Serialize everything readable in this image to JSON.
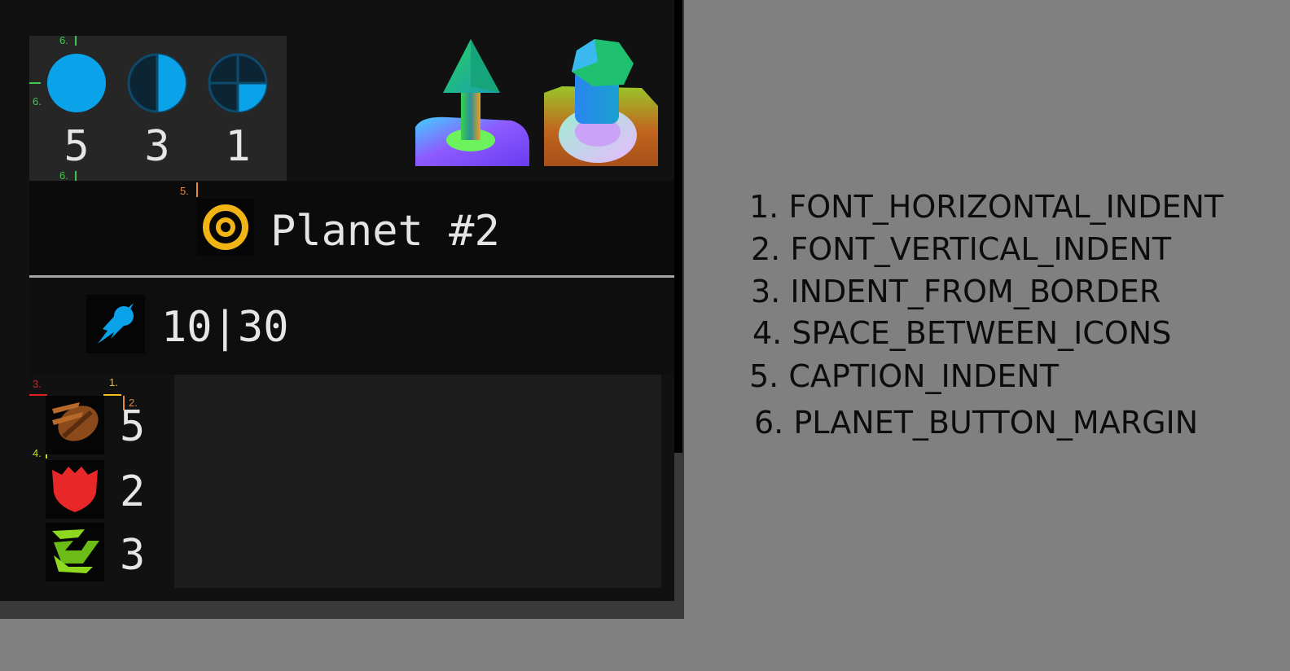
{
  "orbs": {
    "counts": [
      "5",
      "3",
      "1"
    ],
    "icons": [
      "orb-full-icon",
      "orb-half-icon",
      "orb-quarter-icon"
    ],
    "color": "#0aa3ea",
    "tags": {
      "margin_top": "6.",
      "margin_left": "6.",
      "margin_bottom": "6."
    }
  },
  "buildings": {
    "icons": [
      "arrow-tower-building-icon",
      "dome-building-icon"
    ]
  },
  "planet": {
    "name": "Planet #2",
    "icon": "target-ring-icon",
    "caption_tag": "5."
  },
  "population": {
    "icon": "comet-icon",
    "text": "10|30"
  },
  "resources": {
    "tags": {
      "indent_from_border": "3.",
      "font_horizontal": "1.",
      "font_vertical": "2.",
      "space_between_icons": "4."
    },
    "items": [
      {
        "icon": "wood-log-icon",
        "value": "5"
      },
      {
        "icon": "red-shield-icon",
        "value": "2"
      },
      {
        "icon": "green-chevron-icon",
        "value": "3"
      }
    ]
  },
  "legend": [
    "1. FONT_HORIZONTAL_INDENT",
    "2. FONT_VERTICAL_INDENT",
    "3. INDENT_FROM_BORDER",
    "4. SPACE_BETWEEN_ICONS",
    "5. CAPTION_INDENT",
    "6. PLANET_BUTTON_MARGIN"
  ],
  "colors": {
    "panel": "#111111",
    "tag_green": "#3ec84e",
    "tag_red": "#e02020",
    "tag_yellow": "#f0c020",
    "tag_orange": "#e08a3a",
    "tag_lime": "#b8e020"
  }
}
